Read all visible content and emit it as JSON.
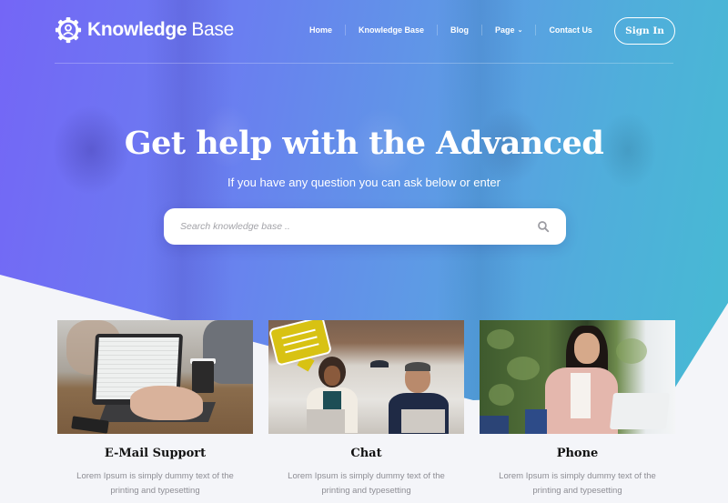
{
  "brand": {
    "icon": "gear-user-icon",
    "name_bold": "Knowledge",
    "name_light": "Base"
  },
  "nav": {
    "items": [
      {
        "label": "Home"
      },
      {
        "label": "Knowledge Base"
      },
      {
        "label": "Blog"
      },
      {
        "label": "Page",
        "has_dropdown": true,
        "caret_icon": "chevron-down-icon"
      },
      {
        "label": "Contact Us"
      }
    ],
    "signin_label": "Sign In"
  },
  "hero": {
    "title": "Get help with the Advanced",
    "subtitle": "If you have any question you can ask below or enter",
    "gradient": {
      "start": "#7466f6",
      "end": "#45bcd2"
    }
  },
  "search": {
    "placeholder": "Search knowledge base ..",
    "value": "",
    "icon": "search-icon"
  },
  "cards": [
    {
      "image": "person typing on laptop with email inbox",
      "title": "E-Mail Support",
      "description": "Lorem Ipsum is simply dummy text of the printing and typesetting"
    },
    {
      "image": "office team with yellow chat bubble",
      "title": "Chat",
      "description": "Lorem Ipsum is simply dummy text of the printing and typesetting"
    },
    {
      "image": "woman talking on phone at laptop",
      "title": "Phone",
      "description": "Lorem Ipsum is simply dummy text of the printing and typesetting"
    }
  ]
}
